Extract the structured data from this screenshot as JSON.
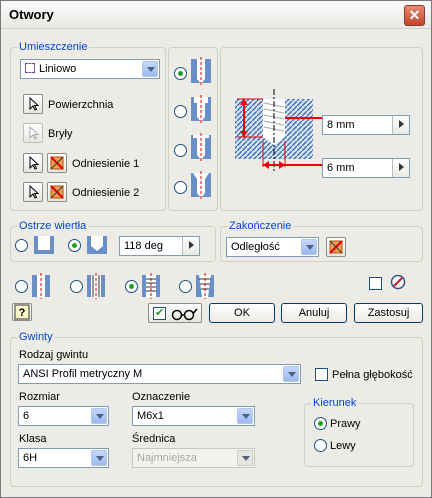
{
  "window": {
    "title": "Otwory"
  },
  "placement": {
    "legend": "Umieszczenie",
    "type_value": "Liniowo",
    "surface_label": "Powierzchnia",
    "solids_label": "Bryły",
    "reference1_label": "Odniesienie 1",
    "reference2_label": "Odniesienie 2"
  },
  "preview": {
    "depth_value": "8 mm",
    "diameter_value": "6 mm"
  },
  "drill_point": {
    "legend": "Ostrze wiertła",
    "angle_value": "118 deg"
  },
  "termination": {
    "legend": "Zakończenie",
    "value": "Odległość"
  },
  "buttons": {
    "ok": "OK",
    "cancel": "Anuluj",
    "apply": "Zastosuj"
  },
  "threads": {
    "legend": "Gwinty",
    "type_label": "Rodzaj gwintu",
    "type_value": "ANSI Profil metryczny M",
    "full_depth_label": "Pełna głębokość",
    "size_label": "Rozmiar",
    "size_value": "6",
    "designation_label": "Oznaczenie",
    "designation_value": "M6x1",
    "class_label": "Klasa",
    "class_value": "6H",
    "diameter_label": "Średnica",
    "diameter_value": "Najmniejsza",
    "direction_legend": "Kierunek",
    "right_label": "Prawy",
    "left_label": "Lewy"
  },
  "colors": {
    "accent": "#0046d5",
    "hatch": "#3a6fb5",
    "dimension": "#e00000"
  }
}
